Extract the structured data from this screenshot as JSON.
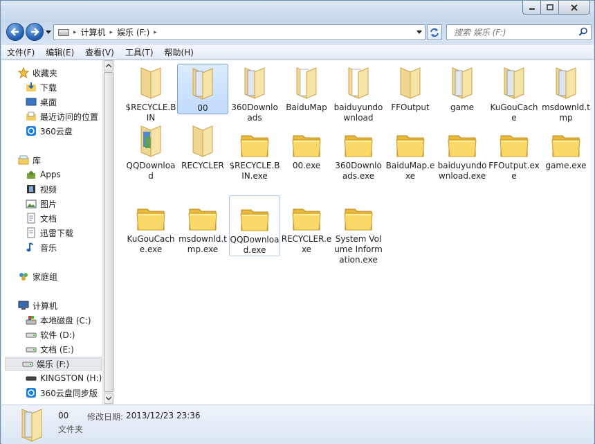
{
  "window": {
    "caption": {
      "min": "minimize-icon",
      "max": "maximize-icon",
      "close": "close-icon"
    }
  },
  "address": {
    "segments": [
      "计算机",
      "娱乐 (F:)"
    ]
  },
  "search": {
    "placeholder": "搜索 娱乐 (F:)"
  },
  "menu": [
    "文件(F)",
    "编辑(E)",
    "查看(V)",
    "工具(T)",
    "帮助(H)"
  ],
  "nav": {
    "favorites": {
      "label": "收藏夹",
      "items": [
        "下载",
        "桌面",
        "最近访问的位置",
        "360云盘"
      ]
    },
    "libraries": {
      "label": "库",
      "items": [
        "Apps",
        "视频",
        "图片",
        "文档",
        "迅雷下载",
        "音乐"
      ]
    },
    "homegroup": {
      "label": "家庭组"
    },
    "computer": {
      "label": "计算机",
      "items": [
        "本地磁盘 (C:)",
        "软件 (D:)",
        "文档 (E:)",
        "娱乐 (F:)",
        "KINGSTON (H:)",
        "360云盘同步版"
      ]
    }
  },
  "files": [
    {
      "name": "$RECYCLE.BIN",
      "kind": "folder-plain"
    },
    {
      "name": "00",
      "kind": "folder-docs"
    },
    {
      "name": "360Downloads",
      "kind": "folder-docs"
    },
    {
      "name": "BaiduMap",
      "kind": "folder-paper"
    },
    {
      "name": "baiduyundownload",
      "kind": "folder-paper"
    },
    {
      "name": "FFOutput",
      "kind": "folder-plain"
    },
    {
      "name": "game",
      "kind": "folder-docs"
    },
    {
      "name": "KuGouCache",
      "kind": "folder-docs"
    },
    {
      "name": "msdownld.tmp",
      "kind": "folder-docs"
    },
    {
      "name": "QQDownload",
      "kind": "folder-books"
    },
    {
      "name": "RECYCLER",
      "kind": "folder-plain"
    },
    {
      "name": "$RECYCLE.BIN.exe",
      "kind": "folder-exe"
    },
    {
      "name": "00.exe",
      "kind": "folder-exe"
    },
    {
      "name": "360Downloads.exe",
      "kind": "folder-exe"
    },
    {
      "name": "BaiduMap.exe",
      "kind": "folder-exe"
    },
    {
      "name": "baiduyundownload.exe",
      "kind": "folder-exe"
    },
    {
      "name": "FFOutput.exe",
      "kind": "folder-exe"
    },
    {
      "name": "game.exe",
      "kind": "folder-exe"
    },
    {
      "name": "KuGouCache.exe",
      "kind": "folder-exe"
    },
    {
      "name": "msdownld.tmp.exe",
      "kind": "folder-exe"
    },
    {
      "name": "QQDownload.exe",
      "kind": "folder-exe"
    },
    {
      "name": "RECYCLER.exe",
      "kind": "folder-exe"
    },
    {
      "name": "System Volume Information.exe",
      "kind": "folder-exe"
    }
  ],
  "details": {
    "name": "00",
    "type": "文件夹",
    "modified_label": "修改日期:",
    "modified_value": "2013/12/23 23:36"
  },
  "colors": {
    "selection": "#cde2fb",
    "folder": "#f6d66d"
  }
}
